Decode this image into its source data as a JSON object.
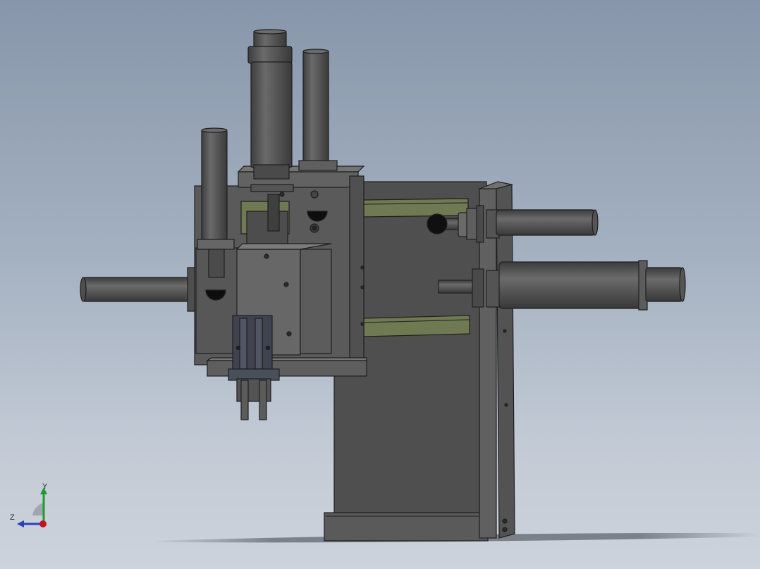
{
  "viewport": {
    "background_top": "#8796aa",
    "background_bottom": "#cdd3dc",
    "part_color": "#575757",
    "part_color_dark": "#3f3f3f",
    "part_color_light": "#6d6d6d",
    "slot_color": "#6f7a52"
  },
  "triad": {
    "y_label": "Y",
    "z_label": "Z",
    "y_color": "#1f9a2e",
    "z_color": "#2b3fbf",
    "x_color": "#c0161b",
    "icon": "coordinate-triad-icon"
  }
}
